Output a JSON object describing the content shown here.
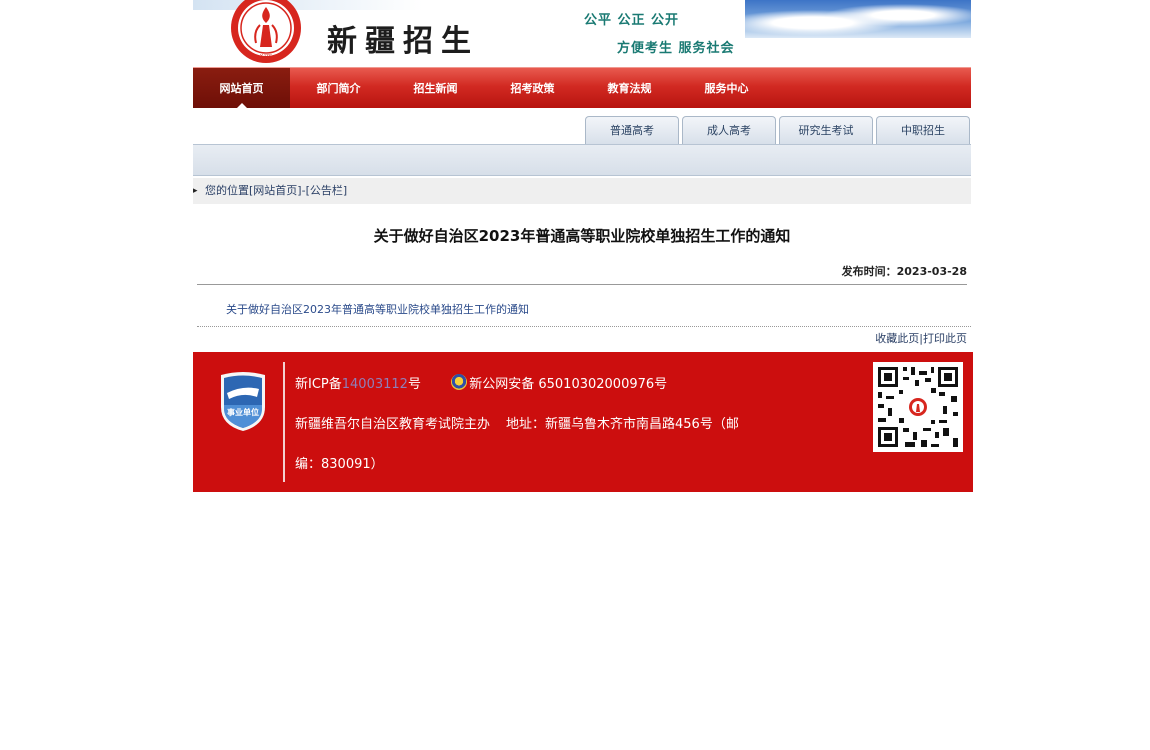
{
  "header": {
    "site_title": "新疆招生",
    "emblem_text": "新疆招生",
    "slogan_1": "公平  公正  公开",
    "slogan_2": "方便考生   服务社会"
  },
  "nav": {
    "items": [
      {
        "label": "网站首页",
        "active": true
      },
      {
        "label": "部门简介",
        "active": false
      },
      {
        "label": "招生新闻",
        "active": false
      },
      {
        "label": "招考政策",
        "active": false
      },
      {
        "label": "教育法规",
        "active": false
      },
      {
        "label": "服务中心",
        "active": false
      }
    ]
  },
  "tabs": [
    "普通高考",
    "成人高考",
    "研究生考试",
    "中职招生"
  ],
  "breadcrumb": {
    "prefix": "您的位置",
    "home": "[网站首页]",
    "sep": "-",
    "section": "[公告栏]"
  },
  "article": {
    "title": "关于做好自治区2023年普通高等职业院校单独招生工作的通知",
    "publish_time": "发布时间：2023-03-28",
    "attachment_link": "关于做好自治区2023年普通高等职业院校单独招生工作的通知"
  },
  "actions": {
    "bookmark": "收藏此页",
    "sep": "|",
    "print": "打印此页"
  },
  "footer": {
    "badge_text": "事业单位",
    "icp_prefix": "新ICP备",
    "icp_number": "14003112",
    "icp_suffix": "号",
    "police_record": "新公网安备 65010302000976号",
    "organizer": "新疆维吾尔自治区教育考试院主办",
    "address_line1": "地址：新疆乌鲁木齐市南昌路456号（邮",
    "address_line2": "编：830091）"
  },
  "colors": {
    "nav_red": "#d22a22",
    "nav_active": "#7a1409",
    "footer_red": "#cc0e0e",
    "slogan_teal": "#1a7a73",
    "link_blue": "#2a4a8a"
  }
}
